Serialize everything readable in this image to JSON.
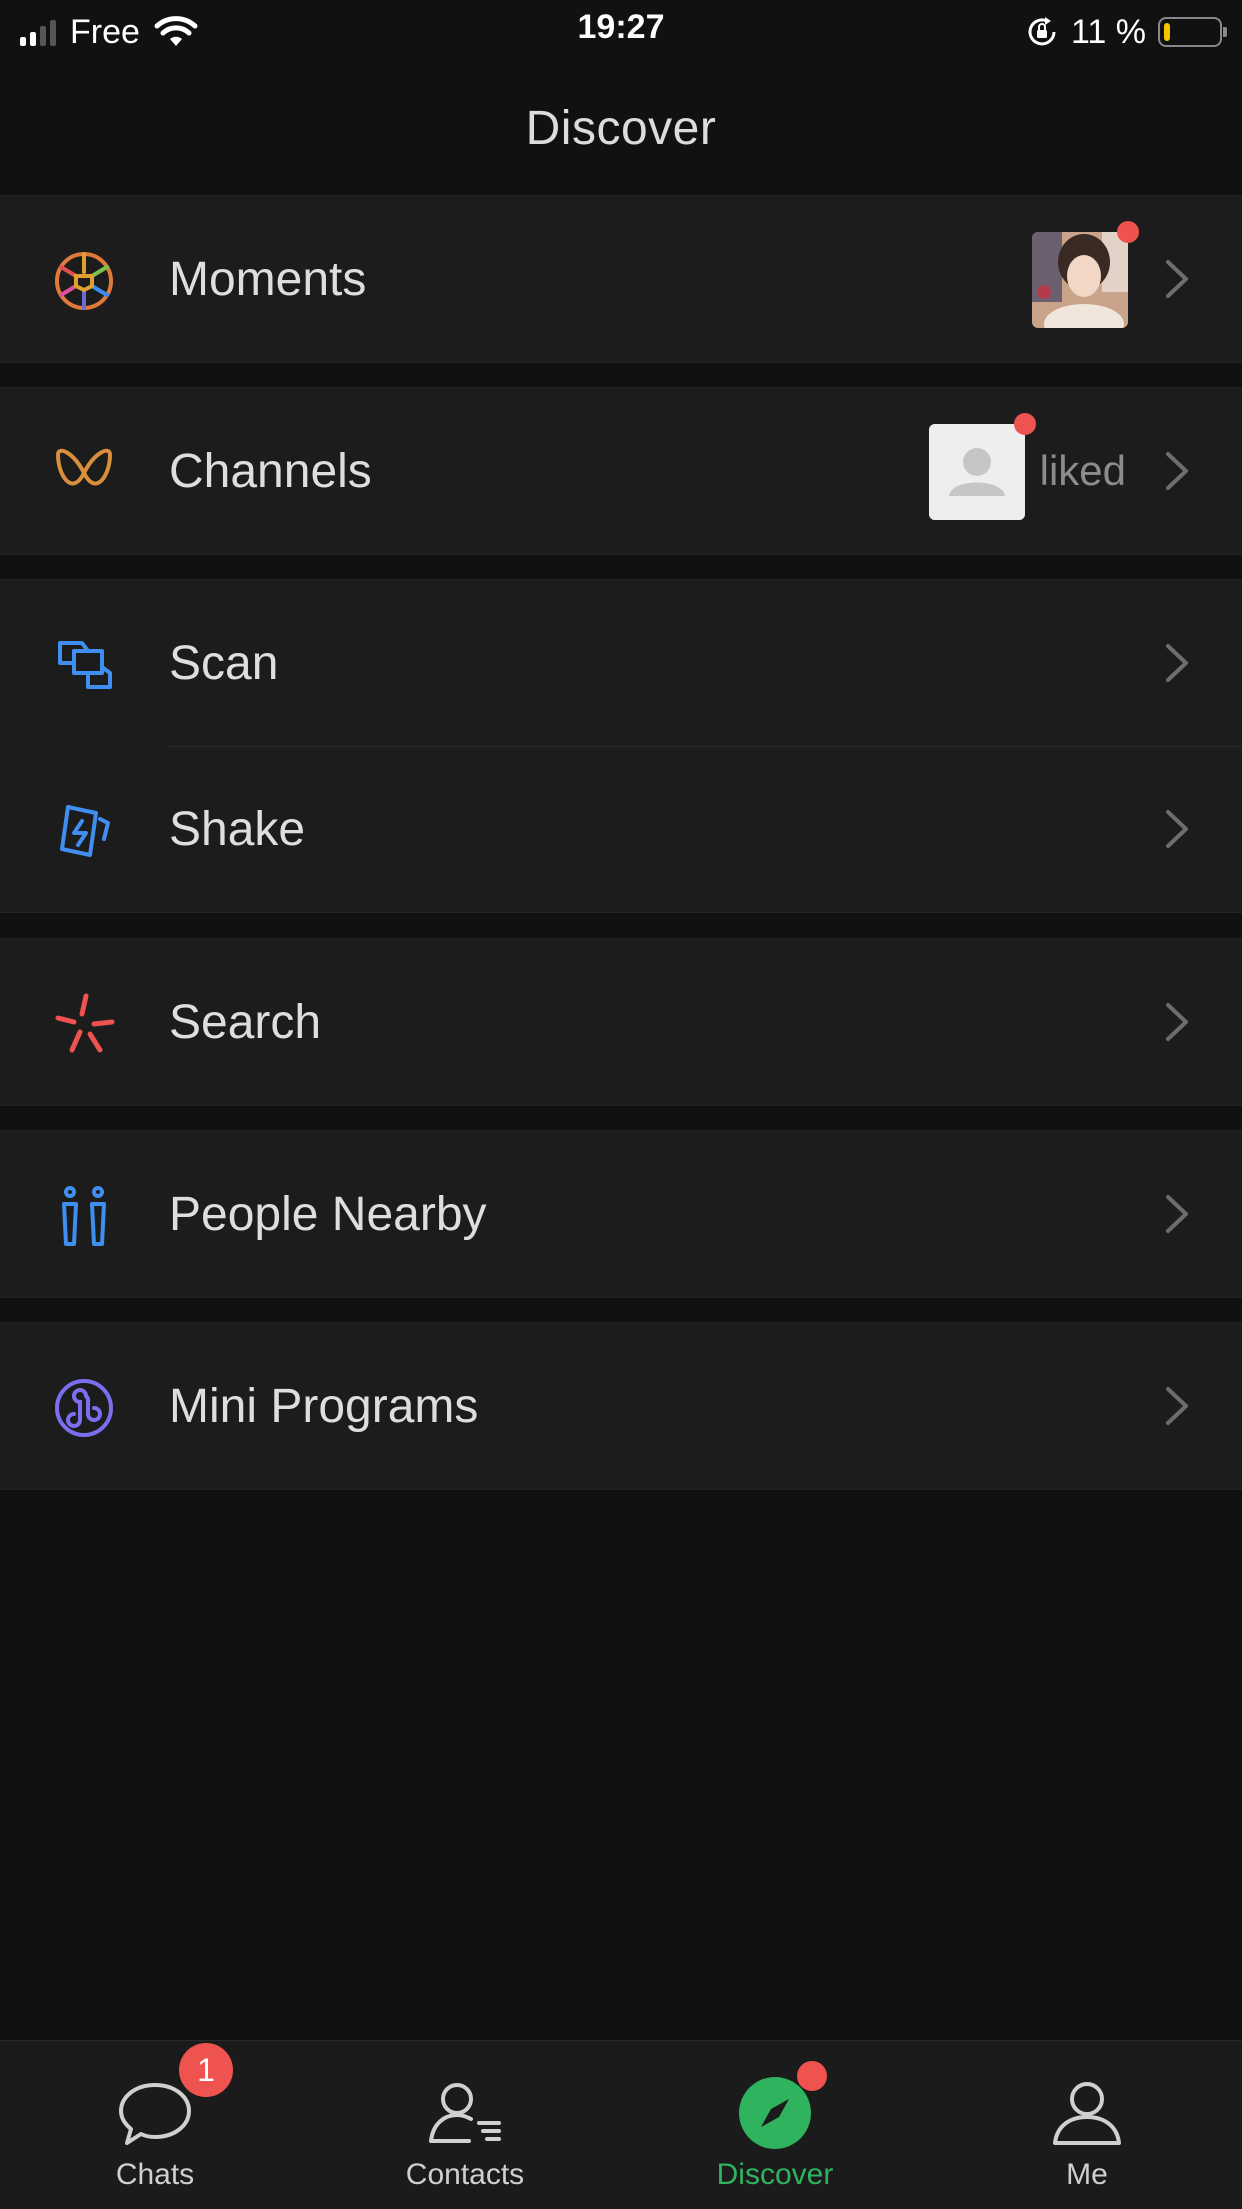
{
  "status_bar": {
    "carrier": "Free",
    "time": "19:27",
    "battery_percent": "11 %",
    "battery_level": 0.11
  },
  "nav": {
    "title": "Discover"
  },
  "menu": {
    "moments": {
      "label": "Moments",
      "has_new": true
    },
    "channels": {
      "label": "Channels",
      "status_text": "liked",
      "has_new": true
    },
    "scan": {
      "label": "Scan"
    },
    "shake": {
      "label": "Shake"
    },
    "search": {
      "label": "Search"
    },
    "people_nearby": {
      "label": "People Nearby"
    },
    "mini_programs": {
      "label": "Mini Programs"
    }
  },
  "tabbar": {
    "tabs": [
      {
        "label": "Chats",
        "icon": "chat-bubble-icon",
        "badge": "1"
      },
      {
        "label": "Contacts",
        "icon": "contacts-icon"
      },
      {
        "label": "Discover",
        "icon": "compass-icon",
        "active": true,
        "has_dot": true
      },
      {
        "label": "Me",
        "icon": "person-icon"
      }
    ]
  },
  "colors": {
    "background": "#111111",
    "row_background": "#1c1c1c",
    "accent_green": "#2fb35e",
    "badge_red": "#ef5350"
  }
}
